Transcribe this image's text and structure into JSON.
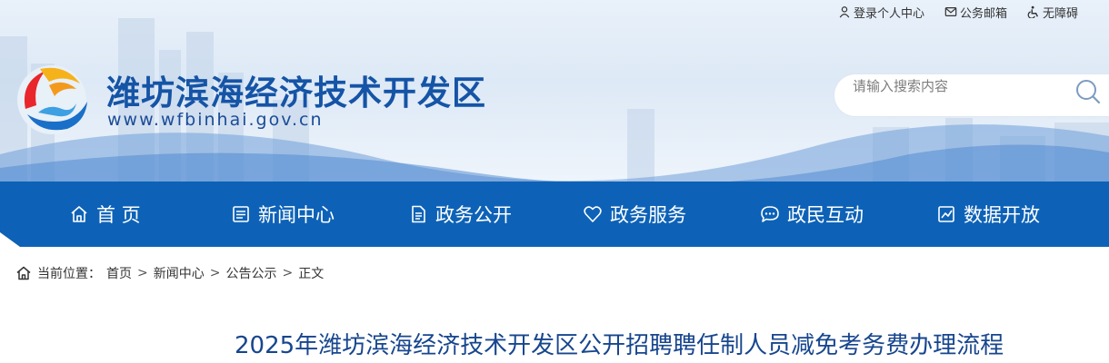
{
  "top_links": [
    {
      "label": "登录个人中心",
      "icon": "user-icon"
    },
    {
      "label": "公务邮箱",
      "icon": "mail-icon"
    },
    {
      "label": "无障碍",
      "icon": "accessibility-icon"
    }
  ],
  "site": {
    "title": "潍坊滨海经济技术开发区",
    "url": "www.wfbinhai.gov.cn"
  },
  "search": {
    "placeholder": "请输入搜索内容"
  },
  "nav": {
    "items": [
      {
        "label": "首 页",
        "icon": "home-icon"
      },
      {
        "label": "新闻中心",
        "icon": "news-icon"
      },
      {
        "label": "政务公开",
        "icon": "document-icon"
      },
      {
        "label": "政务服务",
        "icon": "heart-icon"
      },
      {
        "label": "政民互动",
        "icon": "chat-icon"
      },
      {
        "label": "数据开放",
        "icon": "chart-icon"
      }
    ]
  },
  "breadcrumb": {
    "prefix": "当前位置：",
    "items": [
      "首页",
      "新闻中心",
      "公告公示",
      "正文"
    ],
    "separator": ">"
  },
  "article": {
    "title": "2025年潍坊滨海经济技术开发区公开招聘聘任制人员减免考务费办理流程"
  },
  "colors": {
    "brand_blue": "#1554a6",
    "nav_blue": "#0d62b7",
    "title_blue": "#17468e"
  }
}
